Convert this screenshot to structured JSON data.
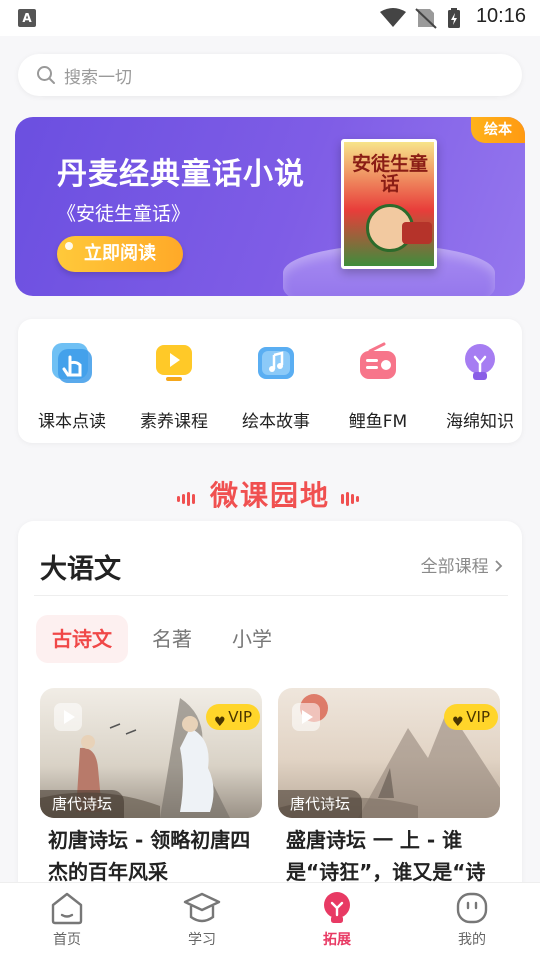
{
  "status_bar": {
    "time": "10:16",
    "notification_letter": "A"
  },
  "search": {
    "placeholder": "搜索一切"
  },
  "banner": {
    "title": "丹麦经典童话小说",
    "subtitle": "《安徒生童话》",
    "button_label": "立即阅读",
    "tag": "绘本",
    "book_title": "安徒生童话"
  },
  "quick_entries": [
    {
      "label": "课本点读",
      "icon": "finger-tap-icon",
      "color": "#4aa8ee"
    },
    {
      "label": "素养课程",
      "icon": "play-screen-icon",
      "color": "#f5b51b"
    },
    {
      "label": "绘本故事",
      "icon": "music-book-icon",
      "color": "#52a8ef"
    },
    {
      "label": "鲤鱼FM",
      "icon": "radio-icon",
      "color": "#f36a7e"
    },
    {
      "label": "海绵知识",
      "icon": "lightbulb-icon",
      "color": "#9b6fee"
    }
  ],
  "section": {
    "title": "微课园地",
    "accent": "#f05050"
  },
  "course": {
    "title": "大语文",
    "all_courses": "全部课程",
    "tabs": [
      "古诗文",
      "名著",
      "小学"
    ],
    "active_tab": 0,
    "videos": [
      {
        "tag": "唐代诗坛",
        "vip": "VIP",
        "title": "初唐诗坛 - 领略初唐四杰的百年风采"
      },
      {
        "tag": "唐代诗坛",
        "vip": "VIP",
        "title": "盛唐诗坛 一 上 - 谁是“诗狂”，谁又是“诗"
      }
    ]
  },
  "nav": {
    "items": [
      {
        "label": "首页",
        "icon": "home-icon"
      },
      {
        "label": "学习",
        "icon": "graduation-cap-icon"
      },
      {
        "label": "拓展",
        "icon": "lightbulb-icon"
      },
      {
        "label": "我的",
        "icon": "profile-icon"
      }
    ],
    "active": 2,
    "active_color": "#e83a64"
  }
}
